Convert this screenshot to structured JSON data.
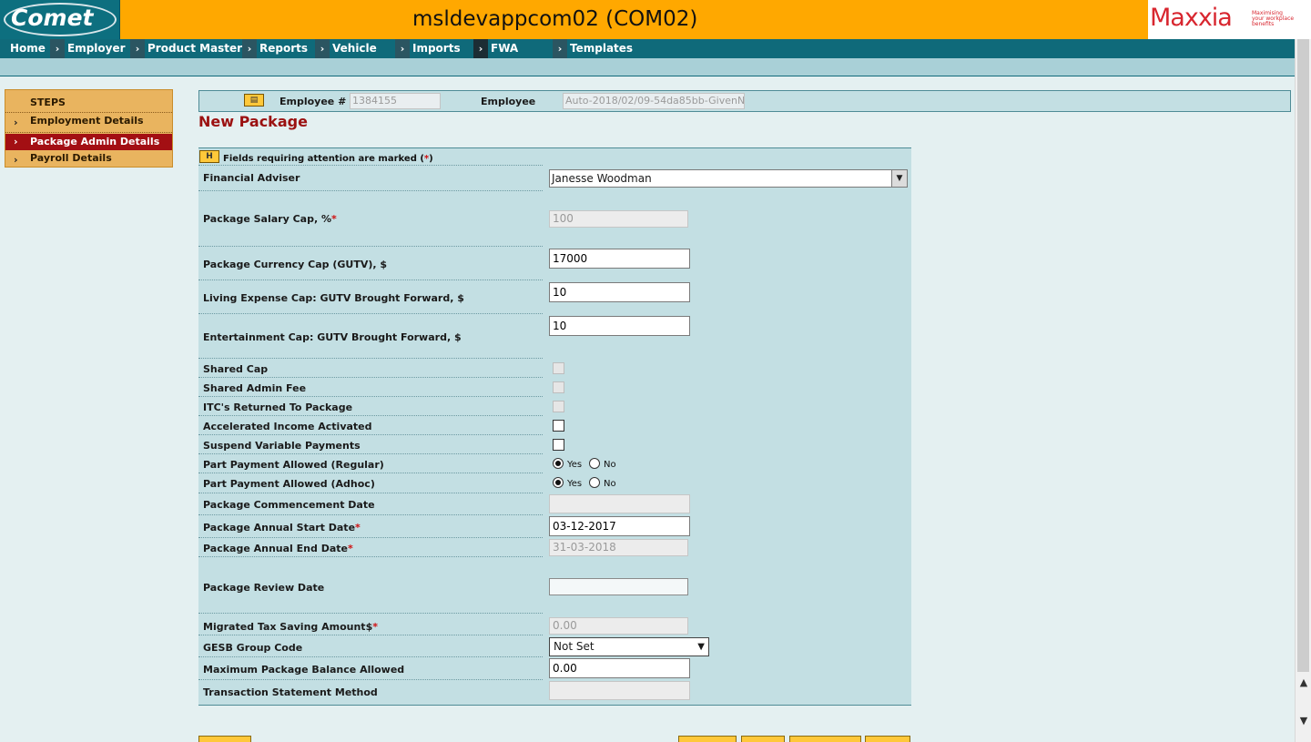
{
  "app": {
    "logo": "Comet",
    "server_title": "msldevappcom02 (COM02)",
    "brand_name": "Maxxia",
    "brand_tagline": "Maximising your workplace benefits"
  },
  "nav": {
    "items": [
      {
        "label": "Home"
      },
      {
        "label": "Employer"
      },
      {
        "label": "Product Master"
      },
      {
        "label": "Reports"
      },
      {
        "label": "Vehicle"
      },
      {
        "label": "Imports"
      },
      {
        "label": "FWA"
      },
      {
        "label": "Templates"
      }
    ]
  },
  "steps": {
    "heading": "STEPS",
    "items": [
      {
        "label": "Employment Details"
      },
      {
        "label": "Package Admin Details"
      },
      {
        "label": "Payroll Details"
      }
    ]
  },
  "employee_bar": {
    "employee_num_label": "Employee #",
    "employee_num_value": "1384155",
    "employee_label": "Employee",
    "employee_value": "Auto-2018/02/09-54da85bb-GivenN"
  },
  "page": {
    "title": "New Package"
  },
  "form": {
    "badge": "H",
    "notice_prefix": "Fields requiring attention are marked (",
    "notice_mark": "*",
    "notice_suffix": ")",
    "financial_adviser": {
      "label": "Financial Adviser",
      "value": "Janesse Woodman"
    },
    "salary_cap": {
      "label": "Package Salary Cap, %",
      "value": "100"
    },
    "currency_cap": {
      "label": "Package Currency Cap (GUTV), $",
      "value": "17000"
    },
    "living_cap": {
      "label": "Living Expense Cap: GUTV Brought Forward, $",
      "value": "10"
    },
    "entertain_cap": {
      "label": "Entertainment Cap: GUTV Brought Forward, $",
      "value": "10"
    },
    "shared_cap": {
      "label": "Shared Cap"
    },
    "shared_admin_fee": {
      "label": "Shared Admin Fee"
    },
    "itc_returned": {
      "label": "ITC's Returned To Package"
    },
    "accel_income": {
      "label": "Accelerated Income Activated"
    },
    "suspend_var": {
      "label": "Suspend Variable Payments"
    },
    "part_regular": {
      "label": "Part Payment Allowed (Regular)",
      "yes": "Yes",
      "no": "No"
    },
    "part_adhoc": {
      "label": "Part Payment Allowed (Adhoc)",
      "yes": "Yes",
      "no": "No"
    },
    "commencement": {
      "label": "Package Commencement Date",
      "value": ""
    },
    "annual_start": {
      "label": "Package Annual Start Date",
      "value": "03-12-2017"
    },
    "annual_end": {
      "label": "Package Annual End Date",
      "value": "31-03-2018"
    },
    "review_date": {
      "label": "Package Review Date",
      "value": ""
    },
    "migrated_tax": {
      "label": "Migrated Tax Saving Amount$",
      "value": "0.00"
    },
    "gesb": {
      "label": "GESB Group Code",
      "value": "Not Set"
    },
    "max_balance": {
      "label": "Maximum Package Balance Allowed",
      "value": "0.00"
    },
    "txn_method": {
      "label": "Transaction Statement Method",
      "value": ""
    },
    "required_mark": "*"
  },
  "colors": {
    "header_orange": "#ffa800",
    "nav_teal": "#0f6a7a",
    "panel_blue": "#c3dfe3",
    "step_gold": "#e9b45f",
    "active_red": "#a30f13",
    "title_red": "#9b1111"
  }
}
